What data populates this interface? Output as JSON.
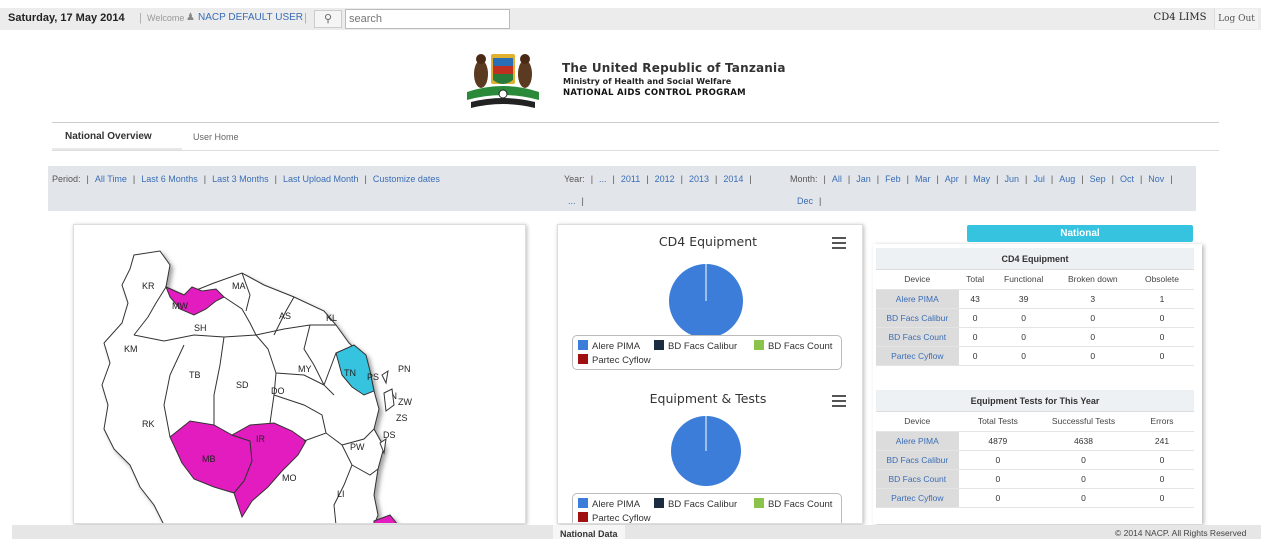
{
  "topbar": {
    "date": "Saturday, 17 May 2014",
    "sep": "|",
    "welcome": "Welcome",
    "username": "NACP DEFAULT USER",
    "search_placeholder": "search",
    "app_name": "CD4 LIMS",
    "logout": "Log Out"
  },
  "header": {
    "title": "The United Republic of Tanzania",
    "ministry": "Ministry of Health and Social Welfare",
    "program": "NATIONAL AIDS CONTROL PROGRAM"
  },
  "tabs": [
    {
      "label": "National Overview",
      "active": true
    },
    {
      "label": "User Home",
      "active": false
    }
  ],
  "filters": {
    "period_label": "Period:",
    "period": [
      "All Time",
      "Last 6 Months",
      "Last 3 Months",
      "Last Upload Month",
      "Customize dates"
    ],
    "year_label": "Year:",
    "years": [
      "...",
      "2011",
      "2012",
      "2013",
      "2014",
      "..."
    ],
    "month_label": "Month:",
    "months": [
      "All",
      "Jan",
      "Feb",
      "Mar",
      "Apr",
      "May",
      "Jun",
      "Jul",
      "Aug",
      "Sep",
      "Oct",
      "Nov",
      "Dec"
    ]
  },
  "map": {
    "regions": [
      "KR",
      "MA",
      "MW",
      "SH",
      "AS",
      "KL",
      "KM",
      "TB",
      "SD",
      "MY",
      "DO",
      "TN",
      "PS",
      "PN",
      "ZN",
      "ZW",
      "ZS",
      "RK",
      "IR",
      "DS",
      "MB",
      "PW",
      "MO",
      "LI"
    ],
    "colors": {
      "highlight": "#e21bbf",
      "selected": "#35c3e0",
      "default": "#ffffff"
    }
  },
  "charts": {
    "cd4": {
      "title": "CD4 Equipment"
    },
    "tests": {
      "title": "Equipment & Tests"
    },
    "legend": [
      {
        "name": "Alere PIMA",
        "color": "#3b7dd8"
      },
      {
        "name": "BD Facs Calibur",
        "color": "#1b2b40"
      },
      {
        "name": "BD Facs Count",
        "color": "#8bc34a"
      },
      {
        "name": "Partec Cyflow",
        "color": "#a01010"
      }
    ]
  },
  "chart_data": [
    {
      "type": "pie",
      "title": "CD4 Equipment",
      "categories": [
        "Alere PIMA",
        "BD Facs Calibur",
        "BD Facs Count",
        "Partec Cyflow"
      ],
      "values": [
        43,
        0,
        0,
        0
      ]
    },
    {
      "type": "pie",
      "title": "Equipment & Tests",
      "categories": [
        "Alere PIMA",
        "BD Facs Calibur",
        "BD Facs Count",
        "Partec Cyflow"
      ],
      "values": [
        4879,
        0,
        0,
        0
      ]
    }
  ],
  "national": {
    "badge": "National",
    "equipment": {
      "title": "CD4 Equipment",
      "headers": [
        "Device",
        "Total",
        "Functional",
        "Broken down",
        "Obsolete"
      ],
      "rows": [
        [
          "Alere PIMA",
          "43",
          "39",
          "3",
          "1"
        ],
        [
          "BD Facs Calibur",
          "0",
          "0",
          "0",
          "0"
        ],
        [
          "BD Facs Count",
          "0",
          "0",
          "0",
          "0"
        ],
        [
          "Partec Cyflow",
          "0",
          "0",
          "0",
          "0"
        ]
      ]
    },
    "tests": {
      "title": "Equipment Tests for This Year",
      "headers": [
        "Device",
        "Total Tests",
        "Successful Tests",
        "Errors"
      ],
      "rows": [
        [
          "Alere PIMA",
          "4879",
          "4638",
          "241"
        ],
        [
          "BD Facs Calibur",
          "0",
          "0",
          "0"
        ],
        [
          "BD Facs Count",
          "0",
          "0",
          "0"
        ],
        [
          "Partec Cyflow",
          "0",
          "0",
          "0"
        ]
      ]
    }
  },
  "footer": {
    "tab": "National Data",
    "copyright": "© 2014 NACP. All Rights Reserved"
  }
}
